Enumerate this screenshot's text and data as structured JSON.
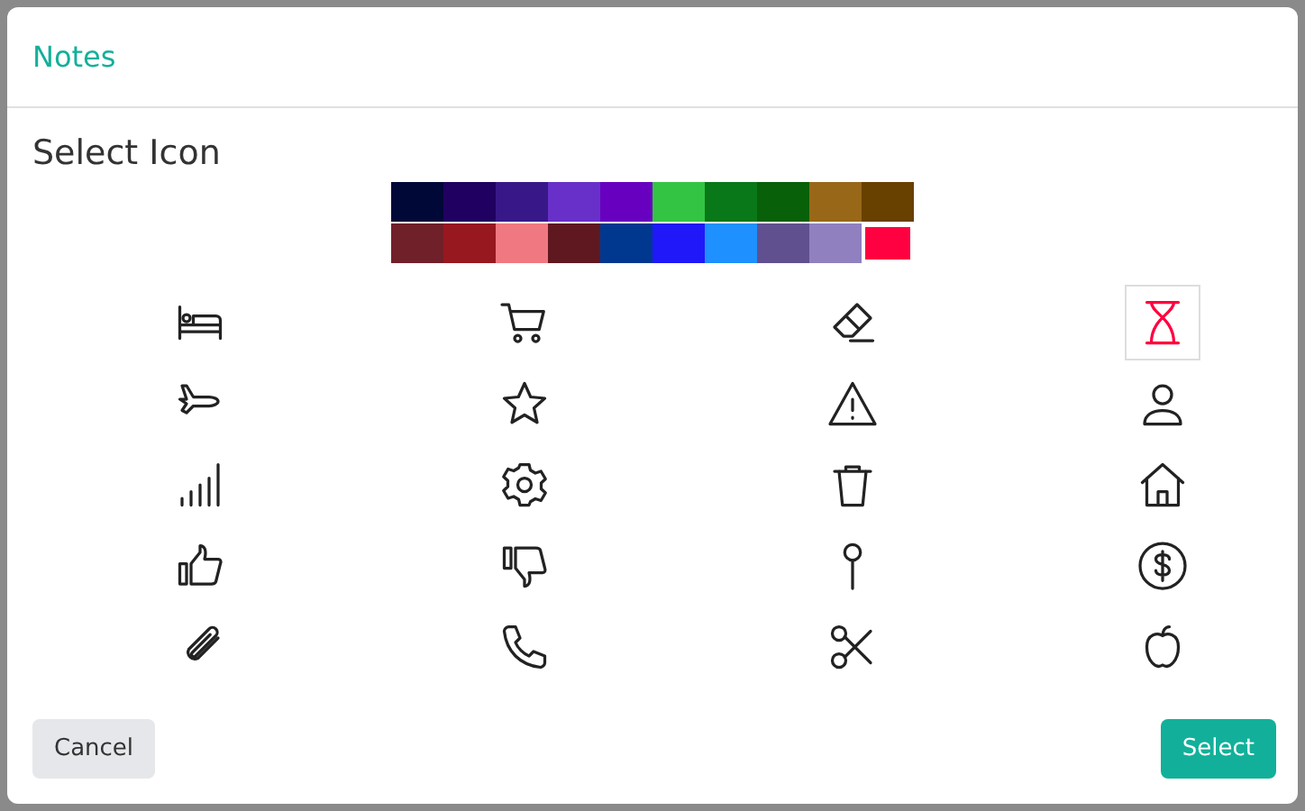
{
  "dialog": {
    "title": "Notes",
    "heading": "Select Icon"
  },
  "colors": [
    {
      "color": "#000838",
      "selected": false
    },
    {
      "color": "#200060",
      "selected": false
    },
    {
      "color": "#381888",
      "selected": false
    },
    {
      "color": "#6830c8",
      "selected": false
    },
    {
      "color": "#6800c0",
      "selected": false
    },
    {
      "color": "#33c444",
      "selected": false
    },
    {
      "color": "#087818",
      "selected": false
    },
    {
      "color": "#086008",
      "selected": false
    },
    {
      "color": "#986818",
      "selected": false
    },
    {
      "color": "#684000",
      "selected": false
    },
    {
      "color": "#702028",
      "selected": false
    },
    {
      "color": "#981820",
      "selected": false
    },
    {
      "color": "#f07880",
      "selected": false
    },
    {
      "color": "#601820",
      "selected": false
    },
    {
      "color": "#003890",
      "selected": false
    },
    {
      "color": "#2018f8",
      "selected": false
    },
    {
      "color": "#1e90ff",
      "selected": false
    },
    {
      "color": "#605090",
      "selected": false
    },
    {
      "color": "#9080c0",
      "selected": false
    },
    {
      "color": "#ff0040",
      "selected": true
    }
  ],
  "icons": [
    {
      "kind": "bed",
      "selected": false
    },
    {
      "kind": "cart",
      "selected": false
    },
    {
      "kind": "eraser",
      "selected": false
    },
    {
      "kind": "hourglass",
      "selected": true
    },
    {
      "kind": "plane",
      "selected": false
    },
    {
      "kind": "star",
      "selected": false
    },
    {
      "kind": "warning",
      "selected": false
    },
    {
      "kind": "person",
      "selected": false
    },
    {
      "kind": "signal",
      "selected": false
    },
    {
      "kind": "gear",
      "selected": false
    },
    {
      "kind": "trash",
      "selected": false
    },
    {
      "kind": "house",
      "selected": false
    },
    {
      "kind": "thumbup",
      "selected": false
    },
    {
      "kind": "thumbdown",
      "selected": false
    },
    {
      "kind": "pin",
      "selected": false
    },
    {
      "kind": "dollar",
      "selected": false
    },
    {
      "kind": "clip",
      "selected": false
    },
    {
      "kind": "phone",
      "selected": false
    },
    {
      "kind": "scissors",
      "selected": false
    },
    {
      "kind": "apple",
      "selected": false
    }
  ],
  "buttons": {
    "cancel": "Cancel",
    "select": "Select"
  }
}
